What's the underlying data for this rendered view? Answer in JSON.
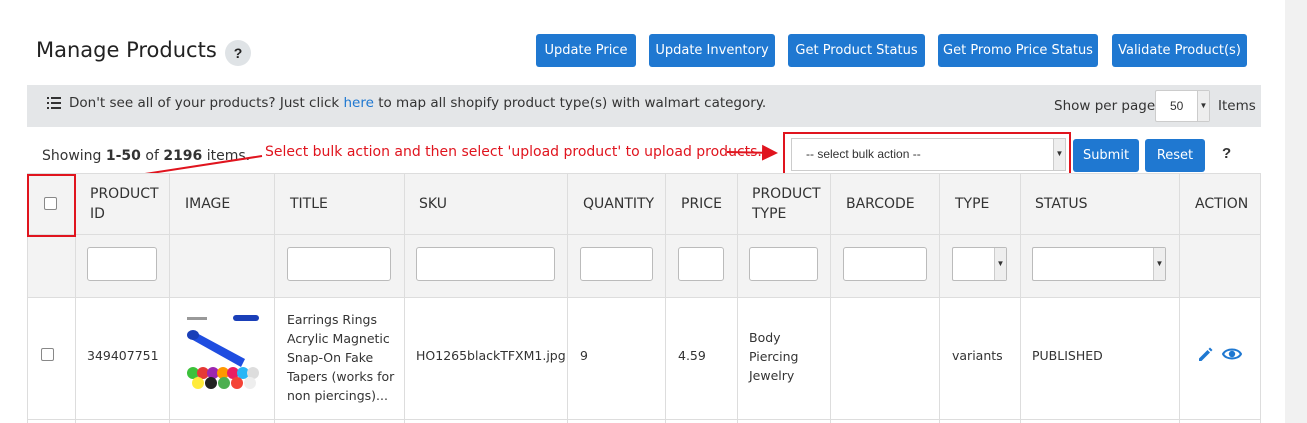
{
  "header": {
    "title": "Manage Products",
    "help": "?",
    "buttons": [
      "Update Price",
      "Update Inventory",
      "Get Product Status",
      "Get Promo Price Status",
      "Validate Product(s)"
    ]
  },
  "infobar": {
    "text_before": "Don't see all of your products? Just click ",
    "link": "here",
    "text_after": " to map all shopify product type(s) with walmart category.",
    "per_page_label": "Show per page",
    "per_page_value": "50",
    "items_label": "Items"
  },
  "toolbar": {
    "showing_prefix": "Showing ",
    "showing_range": "1-50",
    "showing_of": " of ",
    "showing_total": "2196",
    "showing_suffix": " items.",
    "annotation": "Select bulk action and then select 'upload product' to upload products.",
    "bulk_placeholder": "-- select bulk action --",
    "submit": "Submit",
    "reset": "Reset",
    "help": "?"
  },
  "table": {
    "headers": {
      "product_id": "PRODUCT ID",
      "image": "IMAGE",
      "title": "TITLE",
      "sku": "SKU",
      "quantity": "QUANTITY",
      "price": "PRICE",
      "product_type": "PRODUCT TYPE",
      "barcode": "BARCODE",
      "type": "TYPE",
      "status": "STATUS",
      "action": "ACTION"
    },
    "rows": [
      {
        "product_id": "349407751",
        "title": "Earrings Rings Acrylic Magnetic Snap-On Fake Tapers (works for non piercings)...",
        "sku": "HO1265blackTFXM1.jpg",
        "quantity": "9",
        "price": "4.59",
        "product_type": "Body Piercing Jewelry",
        "barcode": "",
        "type": "variants",
        "status": "PUBLISHED"
      }
    ]
  },
  "icons": {
    "list": "list-icon",
    "edit": "pencil-icon",
    "view": "eye-icon"
  },
  "colors": {
    "accent": "#1f78d1",
    "annotation": "#e0141e"
  }
}
